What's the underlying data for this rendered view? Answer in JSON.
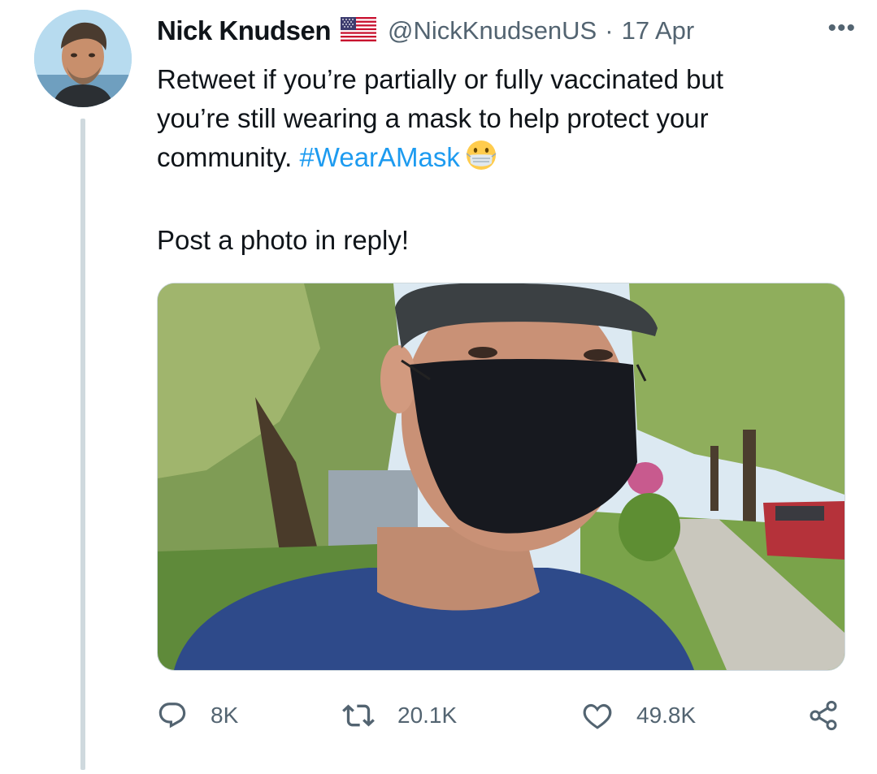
{
  "tweet": {
    "author_name": "Nick Knudsen",
    "author_handle": "@NickKnudsenUS",
    "separator": "·",
    "date": "17 Apr",
    "more_label": "•••",
    "text_line1": "Retweet if you’re partially or fully vaccinated but",
    "text_line2": "you’re still wearing a mask to help protect your",
    "text_line3_prefix": "community. ",
    "hashtag": "#WearAMask",
    "text_paragraph2": "Post a photo in reply!",
    "flag_icon": "us-flag-icon",
    "emoji_icon": "face-with-medical-mask-emoji"
  },
  "actions": {
    "reply_count": "8K",
    "retweet_count": "20.1K",
    "like_count": "49.8K",
    "reply_icon": "reply-icon",
    "retweet_icon": "retweet-icon",
    "like_icon": "heart-icon",
    "share_icon": "share-icon"
  },
  "colors": {
    "link": "#1d9bf0",
    "secondary_text": "#536471",
    "thread_line": "#cfd9de"
  }
}
